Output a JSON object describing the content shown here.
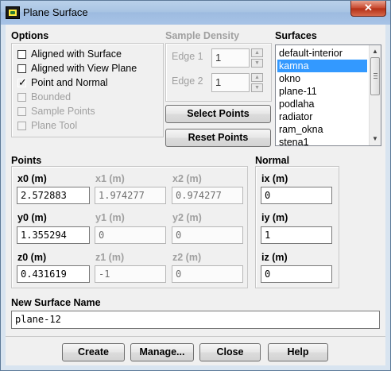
{
  "window": {
    "title": "Plane Surface",
    "close_glyph": "✕",
    "app_icon": "fluent-app-icon"
  },
  "options": {
    "header": "Options",
    "checks": [
      {
        "label": "Aligned with Surface",
        "checked": false,
        "enabled": true
      },
      {
        "label": "Aligned with View Plane",
        "checked": false,
        "enabled": true
      },
      {
        "label": "Point and Normal",
        "checked": true,
        "enabled": true
      },
      {
        "label": "Bounded",
        "checked": false,
        "enabled": false
      },
      {
        "label": "Sample Points",
        "checked": false,
        "enabled": false
      },
      {
        "label": "Plane Tool",
        "checked": false,
        "enabled": false
      }
    ],
    "check_glyph": "✓"
  },
  "sample_density": {
    "header": "Sample Density",
    "edge1_label": "Edge 1",
    "edge1_value": "1",
    "edge2_label": "Edge 2",
    "edge2_value": "1"
  },
  "surfaces": {
    "header": "Surfaces",
    "items": [
      "default-interior",
      "kamna",
      "okno",
      "plane-11",
      "podlaha",
      "radiator",
      "ram_okna",
      "stena1"
    ],
    "selected": "kamna"
  },
  "buttons": {
    "select_points": "Select Points",
    "reset_points": "Reset Points"
  },
  "points": {
    "header": "Points",
    "x0": {
      "label": "x0 (m)",
      "value": "2.572883"
    },
    "x1": {
      "label": "x1 (m)",
      "value": "1.974277"
    },
    "x2": {
      "label": "x2 (m)",
      "value": "0.974277"
    },
    "y0": {
      "label": "y0 (m)",
      "value": "1.355294"
    },
    "y1": {
      "label": "y1 (m)",
      "value": "0"
    },
    "y2": {
      "label": "y2 (m)",
      "value": "0"
    },
    "z0": {
      "label": "z0 (m)",
      "value": "0.431619"
    },
    "z1": {
      "label": "z1 (m)",
      "value": "-1"
    },
    "z2": {
      "label": "z2 (m)",
      "value": "0"
    }
  },
  "normal": {
    "header": "Normal",
    "ix": {
      "label": "ix (m)",
      "value": "0"
    },
    "iy": {
      "label": "iy (m)",
      "value": "1"
    },
    "iz": {
      "label": "iz (m)",
      "value": "0"
    }
  },
  "new_surface": {
    "label": "New Surface Name",
    "value": "plane-12"
  },
  "footer": {
    "create": "Create",
    "manage": "Manage...",
    "close": "Close",
    "help": "Help"
  }
}
